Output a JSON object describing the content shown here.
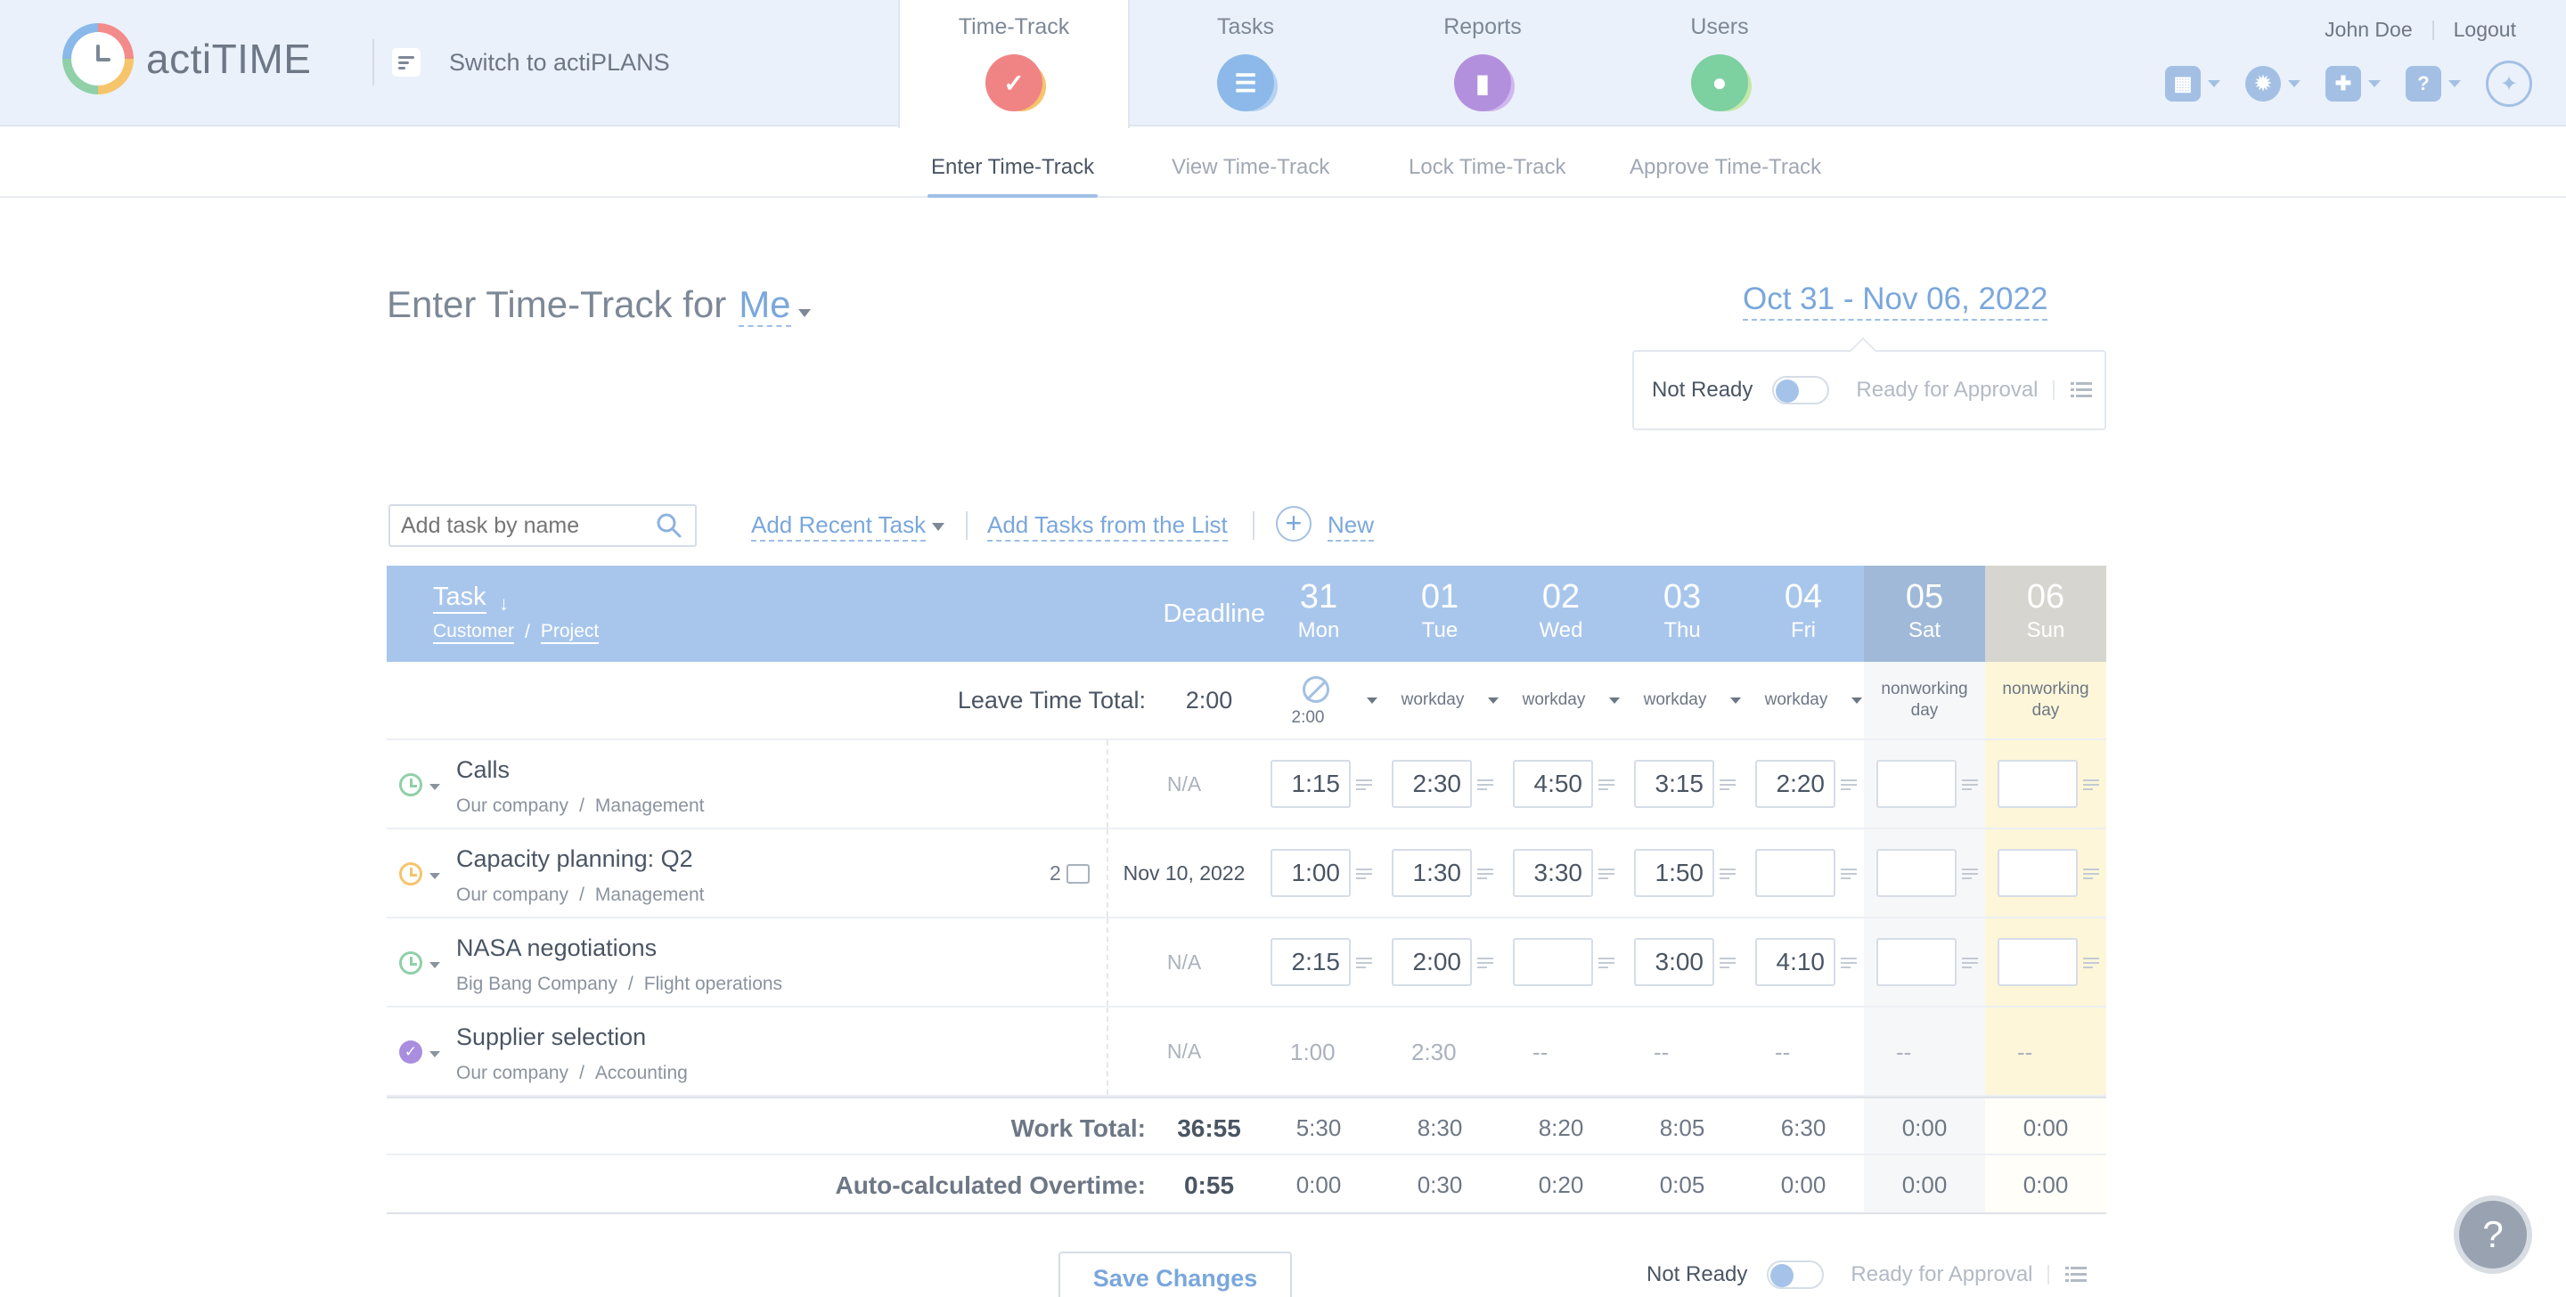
{
  "app": {
    "logo_text": "actiTIME",
    "switch_label": "Switch to actiPLANS",
    "user_name": "John Doe",
    "logout_label": "Logout"
  },
  "nav": {
    "tabs": [
      {
        "label": "Time-Track",
        "icon": "time-track-icon",
        "color": "#f08484",
        "active": true
      },
      {
        "label": "Tasks",
        "icon": "tasks-icon",
        "color": "#8cb9ea",
        "active": false
      },
      {
        "label": "Reports",
        "icon": "reports-icon",
        "color": "#b390dd",
        "active": false
      },
      {
        "label": "Users",
        "icon": "users-icon",
        "color": "#7dd0a0",
        "active": false
      }
    ],
    "tools": [
      "calendar-icon",
      "settings-icon",
      "addons-icon",
      "help-icon",
      "lightbulb-icon"
    ]
  },
  "subnav": {
    "tabs": [
      "Enter Time-Track",
      "View Time-Track",
      "Lock Time-Track",
      "Approve Time-Track"
    ],
    "active_index": 0
  },
  "page": {
    "title_prefix": "Enter Time-Track for",
    "user_select": "Me",
    "date_range": "Oct 31 - Nov 06, 2022",
    "status_not_ready": "Not Ready",
    "status_ready": "Ready for Approval"
  },
  "toolbar": {
    "search_placeholder": "Add task by name",
    "add_recent": "Add Recent Task",
    "add_from_list": "Add Tasks from the List",
    "new_label": "New"
  },
  "grid": {
    "header": {
      "task": "Task",
      "customer": "Customer",
      "separator": "/",
      "project": "Project",
      "deadline": "Deadline"
    },
    "days": [
      {
        "num": "31",
        "name": "Mon"
      },
      {
        "num": "01",
        "name": "Tue"
      },
      {
        "num": "02",
        "name": "Wed"
      },
      {
        "num": "03",
        "name": "Thu"
      },
      {
        "num": "04",
        "name": "Fri"
      },
      {
        "num": "05",
        "name": "Sat"
      },
      {
        "num": "06",
        "name": "Sun"
      }
    ],
    "leave": {
      "label": "Leave Time Total:",
      "total": "2:00",
      "mon_value": "2:00",
      "statuses": [
        "workday",
        "workday",
        "workday",
        "workday"
      ],
      "nonworking_line1": "nonworking",
      "nonworking_line2": "day"
    },
    "tasks": [
      {
        "name": "Calls",
        "customer": "Our company",
        "project": "Management",
        "deadline": "N/A",
        "status": "clock-green",
        "comments": "",
        "hours": [
          "1:15",
          "2:30",
          "4:50",
          "3:15",
          "2:20",
          "",
          ""
        ]
      },
      {
        "name": "Capacity planning: Q2",
        "customer": "Our company",
        "project": "Management",
        "deadline": "Nov 10, 2022",
        "status": "clock-orange",
        "comments": "2",
        "hours": [
          "1:00",
          "1:30",
          "3:30",
          "1:50",
          "",
          "",
          ""
        ]
      },
      {
        "name": "NASA negotiations",
        "customer": "Big Bang Company",
        "project": "Flight operations",
        "deadline": "N/A",
        "status": "clock-green",
        "comments": "",
        "hours": [
          "2:15",
          "2:00",
          "",
          "3:00",
          "4:10",
          "",
          ""
        ]
      },
      {
        "name": "Supplier selection",
        "customer": "Our company",
        "project": "Accounting",
        "deadline": "N/A",
        "status": "completed",
        "comments": "",
        "hours": [
          "1:00",
          "2:30",
          "--",
          "--",
          "--",
          "--",
          "--"
        ]
      }
    ],
    "work_total": {
      "label": "Work Total:",
      "total": "36:55",
      "days": [
        "5:30",
        "8:30",
        "8:20",
        "8:05",
        "6:30",
        "0:00",
        "0:00"
      ]
    },
    "overtime": {
      "label": "Auto-calculated Overtime:",
      "total": "0:55",
      "days": [
        "0:00",
        "0:30",
        "0:20",
        "0:05",
        "0:00",
        "0:00",
        "0:00"
      ]
    }
  },
  "footer": {
    "save_label": "Save Changes",
    "status_not_ready": "Not Ready",
    "status_ready": "Ready for Approval",
    "help_label": "?"
  }
}
